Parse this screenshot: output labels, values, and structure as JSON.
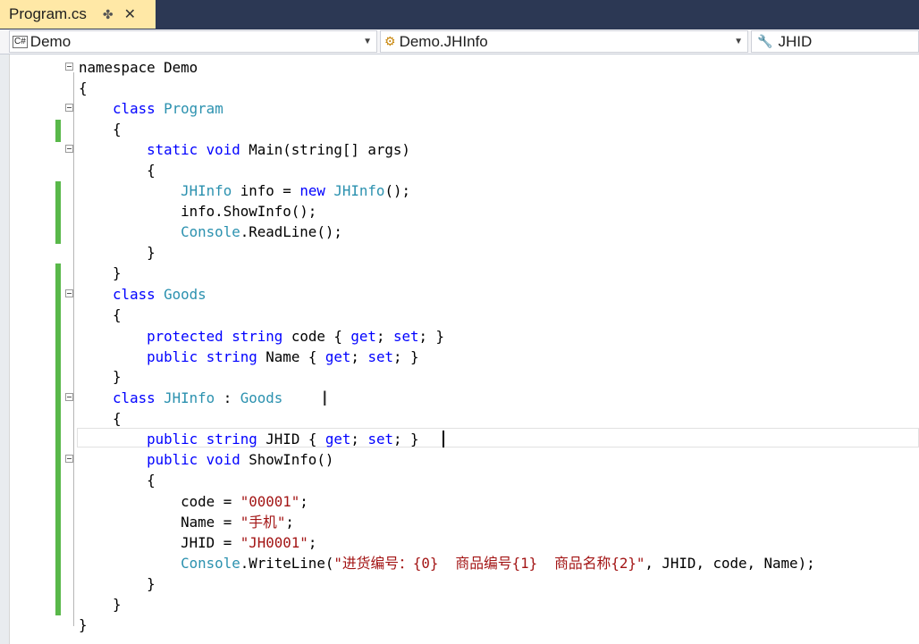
{
  "tab": {
    "title": "Program.cs",
    "pin_glyph": "✤",
    "close_glyph": "✕"
  },
  "nav": {
    "project": "Demo",
    "type": "Demo.JHInfo",
    "member": "JHID",
    "project_icon": "csharp-file-icon",
    "type_icon": "class-icon",
    "member_icon": "wrench-icon"
  },
  "colors": {
    "keyword": "#0000ff",
    "type": "#2b91af",
    "string": "#a31515",
    "tab_active": "#ffe8a6",
    "change_bar": "#59b84a"
  },
  "code": {
    "line1": "namespace Demo",
    "line2": "{",
    "line3": {
      "kw": "class",
      "name": "Program"
    },
    "line4": "{",
    "line5": {
      "kw": "static void",
      "rest": "Main(string[] args)"
    },
    "line6": "{",
    "line7": {
      "t1": "JHInfo",
      "mid": " info = ",
      "kw": "new",
      "t2": "JHInfo",
      "end": "();"
    },
    "line8": "info.ShowInfo();",
    "line9": {
      "t": "Console",
      "rest": ".ReadLine();"
    },
    "line10": "}",
    "line11": "}",
    "line12": {
      "kw": "class",
      "name": "Goods"
    },
    "line13": "{",
    "line14": {
      "kw1": "protected",
      "kw2": "string",
      "mid": "code { ",
      "g": "get",
      "sep": "; ",
      "s": "set",
      "end": "; }"
    },
    "line15": {
      "kw1": "public",
      "kw2": "string",
      "mid": "Name { ",
      "g": "get",
      "sep": "; ",
      "s": "set",
      "end": "; }"
    },
    "line16": "}",
    "line17": {
      "kw": "class",
      "name": "JHInfo",
      "colon": " : ",
      "base": "Goods"
    },
    "line18": "{",
    "line19": {
      "kw1": "public",
      "kw2": "string",
      "mid": "JHID { ",
      "g": "get",
      "sep": "; ",
      "s": "set",
      "end": "; }"
    },
    "line20": {
      "kw": "public void",
      "rest": "ShowInfo()"
    },
    "line21": "{",
    "line22": {
      "pre": "code = ",
      "str": "\"00001\"",
      "end": ";"
    },
    "line23": {
      "pre": "Name = ",
      "str": "\"手机\"",
      "end": ";"
    },
    "line24": {
      "pre": "JHID = ",
      "str": "\"JH0001\"",
      "end": ";"
    },
    "line25": {
      "t": "Console",
      "mid": ".WriteLine(",
      "str": "\"进货编号：{0}  商品编号{1}  商品名称{2}\"",
      "end": ", JHID, code, Name);"
    },
    "line26": "}",
    "line27": "}",
    "line28": "}"
  }
}
